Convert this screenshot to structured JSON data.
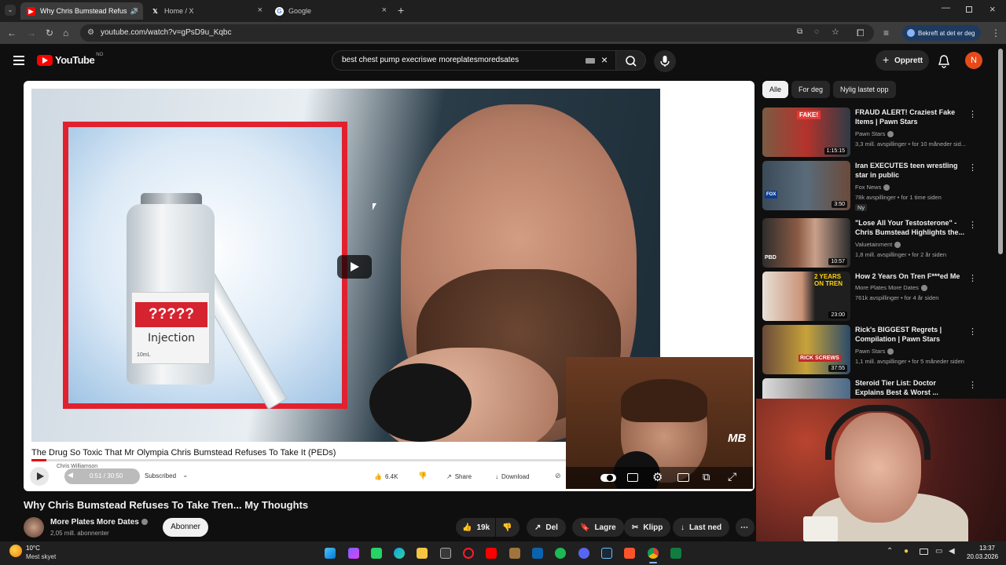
{
  "browser": {
    "tabs": [
      {
        "label": "Why Chris Bumstead Refus",
        "icon": "youtube-favicon"
      },
      {
        "label": "Home / X",
        "icon": "x-favicon"
      },
      {
        "label": "Google",
        "icon": "google-favicon"
      }
    ],
    "new_tab": "+",
    "url": "youtube.com/watch?v=gPsD9u_Kqbc",
    "profile_label": "Bekreft at det er deg"
  },
  "youtube": {
    "logo": "YouTube",
    "region": "NO",
    "search_value": "best chest pump execriswe moreplatesmoredsates",
    "create_label": "Opprett",
    "avatar_letter": "N"
  },
  "player": {
    "overlay_title": "The Drug So Toxic That Mr Olympia Chris Bumstead Refuses To Take It (PEDs)",
    "inset_label_red": "?????",
    "inset_label": "Injection",
    "inset_small": "10mL",
    "channel_small": "Chris Williamson",
    "time": "0:51 / 30:50",
    "subscribed": "Subscribed",
    "likes": "6.4K",
    "share": "Share",
    "download": "Download",
    "progress": 0.028,
    "webcam_logo": "MB"
  },
  "video": {
    "title": "Why Chris Bumstead Refuses To Take Tren... My Thoughts",
    "channel": "More Plates More Dates",
    "subscribers": "2,05 mill. abonnenter",
    "subscribe": "Abonner",
    "likes": "19k",
    "share": "Del",
    "save": "Lagre",
    "clip": "Klipp",
    "download": "Last ned"
  },
  "sidebar": {
    "chips": [
      "Alle",
      "For deg",
      "Nylig lastet opp"
    ],
    "recs": [
      {
        "title": "FRAUD ALERT! Craziest Fake Items | Pawn Stars",
        "channel": "Pawn Stars",
        "meta": "3,3 mill. avspillinger • for 10 måneder sid...",
        "duration": "1:15:15",
        "badge": ""
      },
      {
        "title": "Iran EXECUTES teen wrestling star in public",
        "channel": "Fox News",
        "meta": "78k avspillinger • for 1 time siden",
        "duration": "3:50",
        "badge": "Ny"
      },
      {
        "title": "\"Lose All Your Testosterone\" - Chris Bumstead Highlights the...",
        "channel": "Valuetainment",
        "meta": "1,8 mill. avspillinger • for 2 år siden",
        "duration": "10:57",
        "badge": ""
      },
      {
        "title": "How 2 Years On Tren F***ed Me",
        "channel": "More Plates More Dates",
        "meta": "761k avspillinger • for 4 år siden",
        "duration": "23:00",
        "badge": ""
      },
      {
        "title": "Rick's BIGGEST Regrets | Compilation | Pawn Stars",
        "channel": "Pawn Stars",
        "meta": "1,1 mill. avspillinger • for 5 måneder siden",
        "duration": "37:55",
        "badge": ""
      },
      {
        "title": "Steroid Tier List: Doctor Explains Best & Worst ...",
        "channel": "",
        "meta": "",
        "duration": "",
        "badge": ""
      }
    ]
  },
  "taskbar": {
    "temp": "10°C",
    "weather": "Mest skyet",
    "time": "13:37",
    "date": "20.03.2026"
  },
  "colors": {
    "accent_red": "#ff0000",
    "bg": "#0f0f0f",
    "avatar": "#e64a19"
  }
}
